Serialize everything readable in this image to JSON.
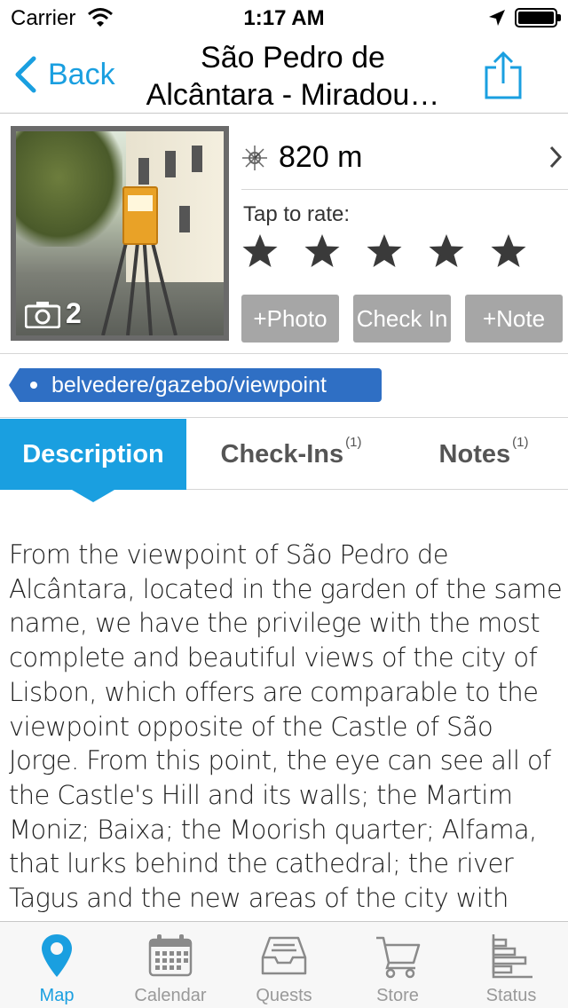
{
  "status_bar": {
    "carrier": "Carrier",
    "time": "1:17 AM"
  },
  "nav": {
    "back_label": "Back",
    "title_line1": "São Pedro de",
    "title_line2": "Alcântara - Miradou…"
  },
  "place": {
    "photo_count": "2",
    "distance": "820 m",
    "rate_label": "Tap to rate:",
    "rating": 0,
    "stars_total": 5
  },
  "actions": {
    "photo": "+Photo",
    "check_in": "Check In",
    "note": "+Note"
  },
  "tag": "belvedere/gazebo/viewpoint",
  "tabs": {
    "description": "Description",
    "checkins": "Check-Ins",
    "checkins_count": "(1)",
    "notes": "Notes",
    "notes_count": "(1)"
  },
  "description": "From the viewpoint of São Pedro de Alcântara, located in the garden of the same name, we have the privilege with the most complete and beautiful views of the city of Lisbon, which offers are comparable to the viewpoint opposite of the Castle of São Jorge. From this point, the eye can see all of the Castle's Hill and its walls; the Martim Moniz; Baixa; the Moorish quarter; Alfama, that lurks behind the cathedral; the river Tagus and the new areas of the city with broad avenues and modern",
  "tab_bar": {
    "items": [
      {
        "label": "Map",
        "icon": "map-pin-icon",
        "active": true
      },
      {
        "label": "Calendar",
        "icon": "calendar-icon",
        "active": false
      },
      {
        "label": "Quests",
        "icon": "inbox-tray-icon",
        "active": false
      },
      {
        "label": "Store",
        "icon": "cart-icon",
        "active": false
      },
      {
        "label": "Status",
        "icon": "bar-chart-icon",
        "active": false
      }
    ]
  },
  "colors": {
    "accent": "#1a9fe0",
    "tag": "#2f6fc4",
    "button_gray": "#a6a6a6",
    "star": "#3a3a3a"
  }
}
